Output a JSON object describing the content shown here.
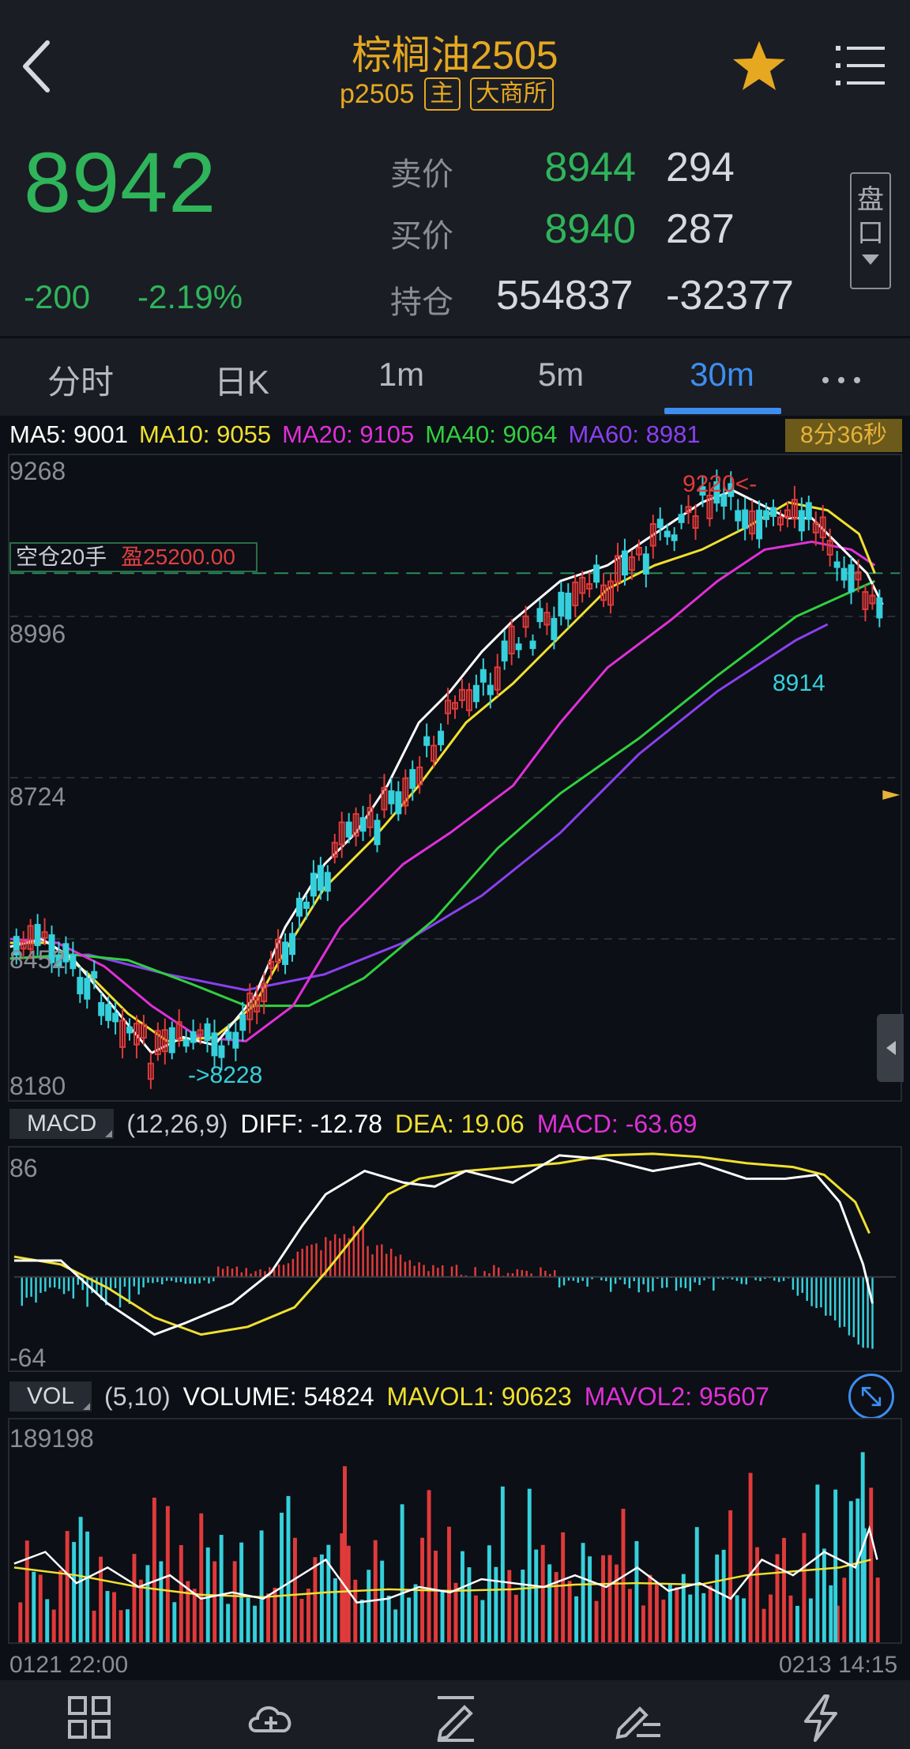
{
  "header": {
    "title": "棕榈油2505",
    "code": "p2505",
    "tag_main": "主",
    "tag_exchange": "大商所"
  },
  "quote": {
    "last": "8942",
    "change": "-200",
    "change_pct": "-2.19%",
    "ask_label": "卖价",
    "ask_price": "8944",
    "ask_vol": "294",
    "bid_label": "买价",
    "bid_price": "8940",
    "bid_vol": "287",
    "oi_label": "持仓",
    "oi_value": "554837",
    "oi_change": "-32377",
    "pankou_label_1": "盘",
    "pankou_label_2": "口"
  },
  "tabs": [
    {
      "label": "分时"
    },
    {
      "label": "日K"
    },
    {
      "label": "1m"
    },
    {
      "label": "5m"
    },
    {
      "label": "30m"
    }
  ],
  "tab_active": "30m",
  "ma": {
    "ma5": "MA5: 9001",
    "ma10": "MA10: 9055",
    "ma20": "MA20: 9105",
    "ma40": "MA40: 9064",
    "ma60": "MA60: 8981",
    "countdown": "8分36秒"
  },
  "position": {
    "label": "空仓20手",
    "profit": "盈25200.00"
  },
  "price_axis": {
    "labels": [
      "9268",
      "8996",
      "8724",
      "8452",
      "8180"
    ],
    "high_mark": "9220<-",
    "low_mark": "->8228",
    "ma_mark": "8914"
  },
  "macd": {
    "badge": "MACD",
    "params": "(12,26,9)",
    "diff": "DIFF: -12.78",
    "dea": "DEA: 19.06",
    "macd": "MACD: -63.69",
    "axis_top": "86",
    "axis_bottom": "-64"
  },
  "vol": {
    "badge": "VOL",
    "params": "(5,10)",
    "volume": "VOLUME: 54824",
    "mavol1": "MAVOL1: 90623",
    "mavol2": "MAVOL2: 95607",
    "axis_top": "189198"
  },
  "time_axis": {
    "start": "0121 22:00",
    "end": "0213 14:15"
  },
  "colors": {
    "up": "#e03a3a",
    "down": "#35d0dc",
    "green": "#2fb45a",
    "accent": "#3d8ef0",
    "gold": "#e6a820"
  },
  "icons": {
    "back": "chevron-left-icon",
    "favorite": "star-icon",
    "menu": "list-menu-icon",
    "expand": "expand-arrows-icon",
    "nav": [
      "grid-icon",
      "cloud-add-icon",
      "draw-pen-icon",
      "edit-list-icon",
      "lightning-icon"
    ]
  }
}
